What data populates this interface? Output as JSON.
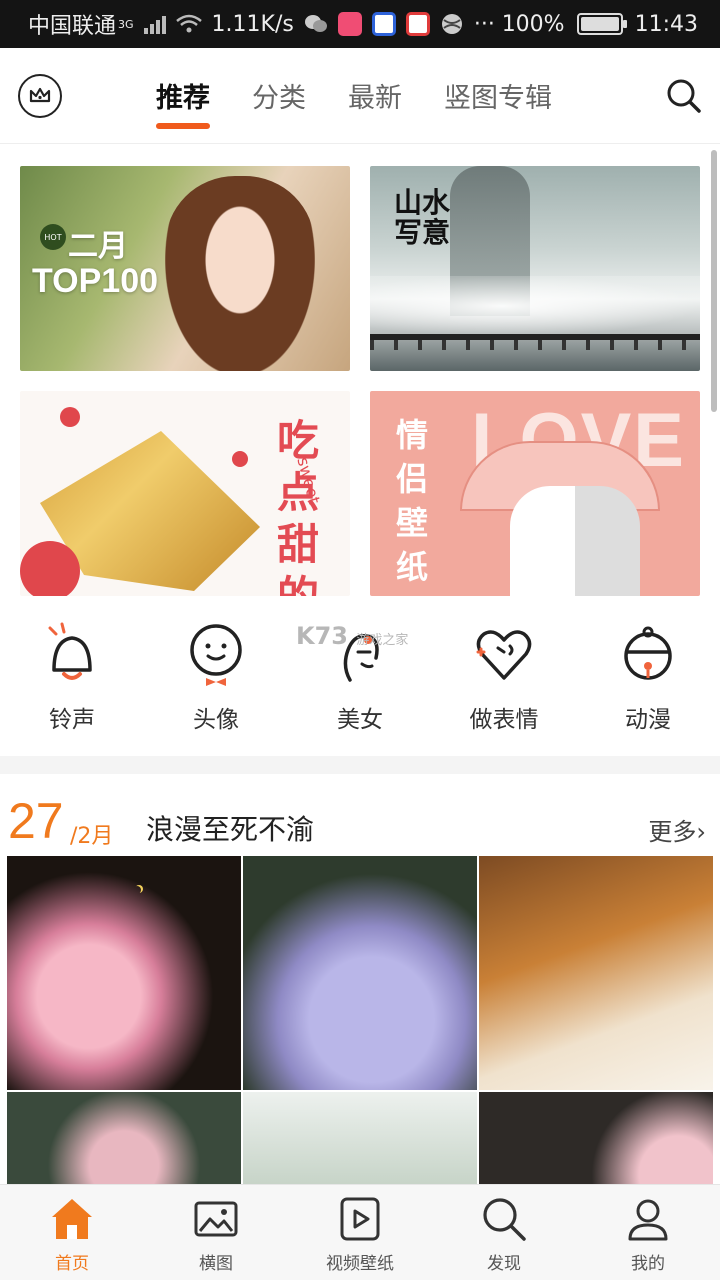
{
  "status_bar": {
    "carrier": "中国联通",
    "network_type": "3G",
    "speed": "1.11K/s",
    "battery": "100%",
    "time": "11:43",
    "more_glyph": "···"
  },
  "top_nav": {
    "tabs": [
      {
        "label": "推荐",
        "active": true
      },
      {
        "label": "分类",
        "active": false
      },
      {
        "label": "最新",
        "active": false
      },
      {
        "label": "竖图专辑",
        "active": false
      }
    ],
    "accent": "#f05a1c"
  },
  "banners": [
    {
      "badge": "HOT",
      "line1": "二月",
      "line2": "TOP100"
    },
    {
      "title": "山水写意"
    },
    {
      "title": "吃点甜的",
      "subtitle": "sweet"
    },
    {
      "title": "情侣壁纸",
      "overlay": "LOVE"
    }
  ],
  "categories": [
    {
      "label": "铃声",
      "icon": "bell-icon"
    },
    {
      "label": "头像",
      "icon": "smiley-icon"
    },
    {
      "label": "美女",
      "icon": "girl-icon"
    },
    {
      "label": "做表情",
      "icon": "heart-face-icon"
    },
    {
      "label": "动漫",
      "icon": "anime-bell-icon"
    }
  ],
  "watermark": {
    "text": "K73",
    "sub": "游戏之家"
  },
  "section": {
    "day": "27",
    "month": "/2月",
    "title": "浪漫至死不渝",
    "more": "更多›"
  },
  "bottom_nav": [
    {
      "label": "首页",
      "icon": "home-icon",
      "active": true
    },
    {
      "label": "横图",
      "icon": "image-icon",
      "active": false
    },
    {
      "label": "视频壁纸",
      "icon": "video-icon",
      "active": false
    },
    {
      "label": "发现",
      "icon": "discover-icon",
      "active": false
    },
    {
      "label": "我的",
      "icon": "profile-icon",
      "active": false
    }
  ],
  "colors": {
    "orange": "#f07a1e",
    "text": "#333333"
  }
}
